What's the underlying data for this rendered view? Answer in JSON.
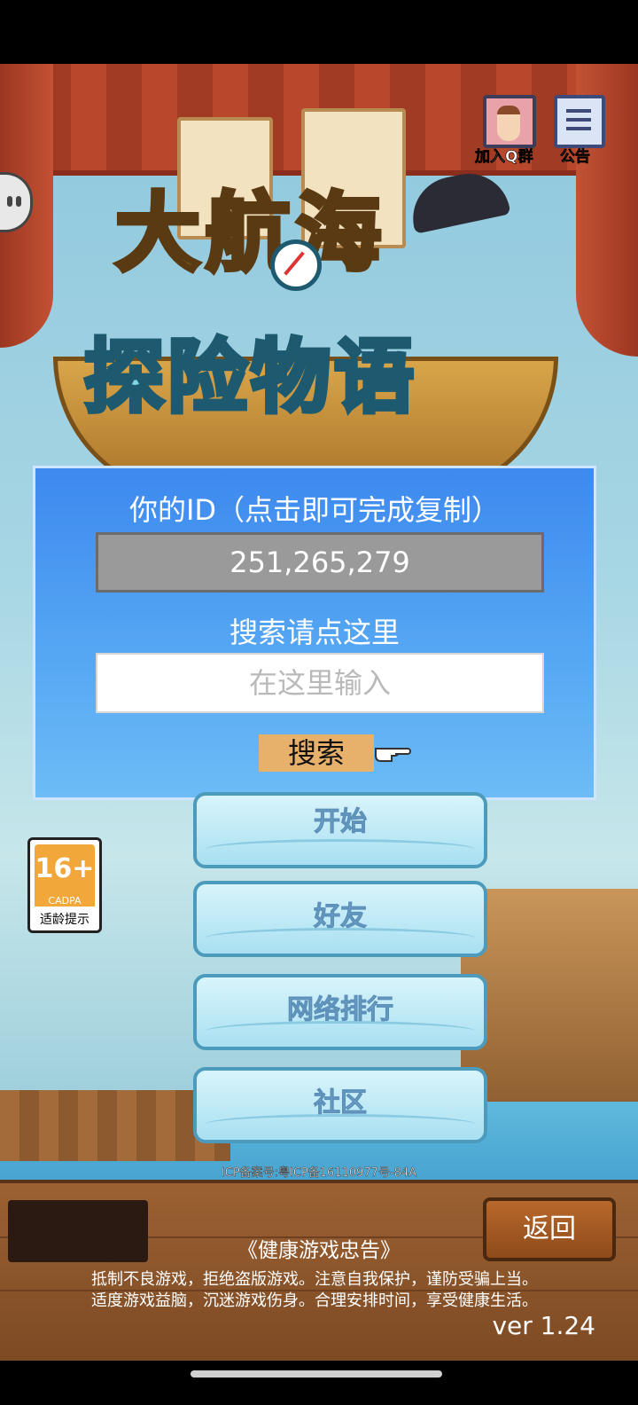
{
  "top_icons": {
    "join_group_label": "加入Q群",
    "announcement_label": "公告"
  },
  "logo": {
    "line1": "大航海",
    "line2": "探险物语"
  },
  "id_panel": {
    "title": "你的ID（点击即可完成复制）",
    "id_value": "251,265,279",
    "search_label": "搜索请点这里",
    "search_placeholder": "在这里输入",
    "search_button": "搜索"
  },
  "menu": {
    "start": "开始",
    "friends": "好友",
    "ranking": "网络排行",
    "community": "社区"
  },
  "age_badge": {
    "rating": "16+",
    "org": "CADPA",
    "tip": "适龄提示"
  },
  "icp": "ICP备案号:粤ICP备16110977号-84A",
  "footer": {
    "back_button": "返回",
    "health_title": "《健康游戏忠告》",
    "health_line1": "抵制不良游戏，拒绝盗版游戏。注意自我保护，谨防受骗上当。",
    "health_line2": "适度游戏益脑，沉迷游戏伤身。合理安排时间，享受健康生活。",
    "version": "ver 1.24"
  }
}
